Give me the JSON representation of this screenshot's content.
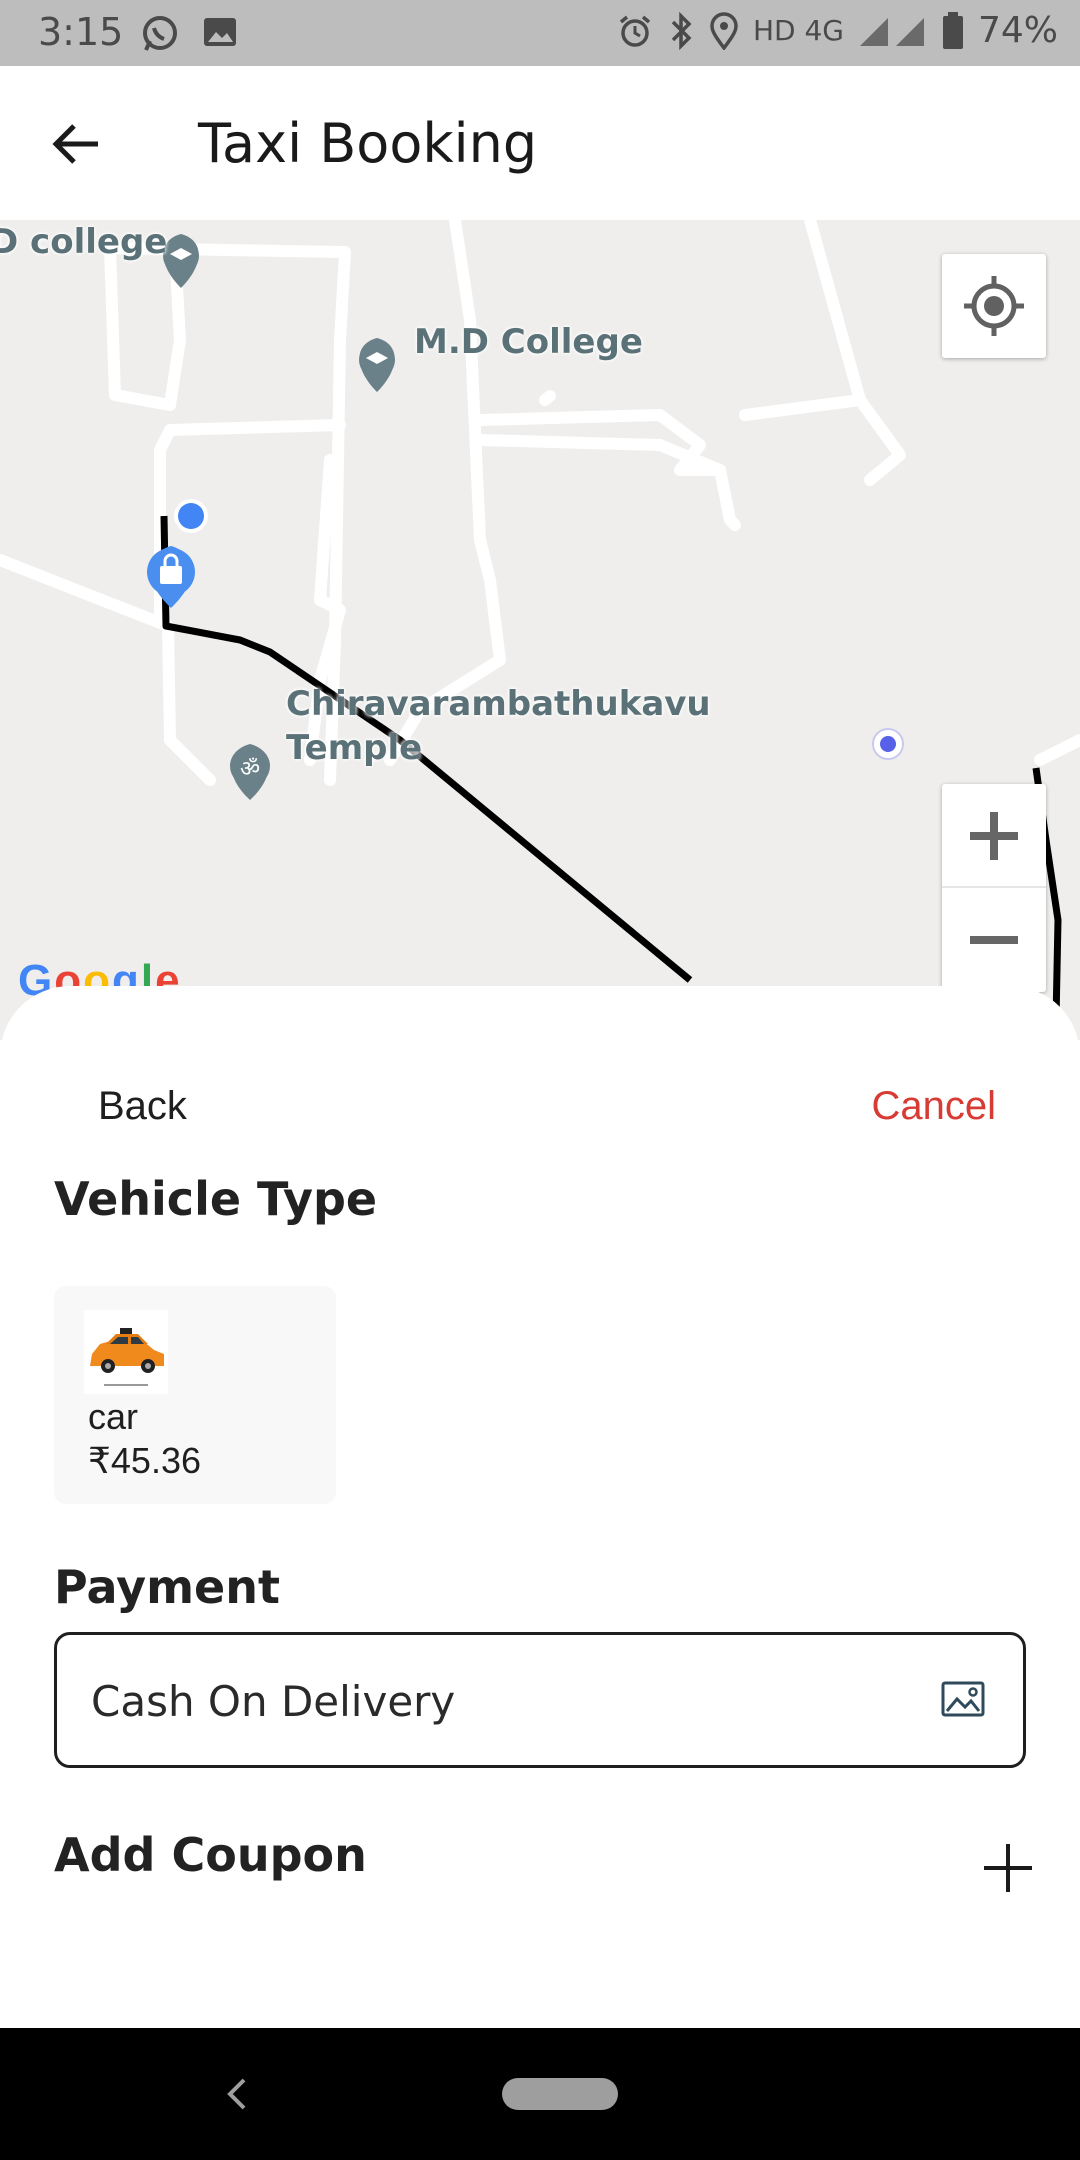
{
  "status_bar": {
    "time": "3:15",
    "network": "HD 4G",
    "battery": "74%",
    "icons": [
      "whatsapp-icon",
      "gallery-icon",
      "alarm-icon",
      "bluetooth-icon",
      "location-icon",
      "signal-icon",
      "battery-icon"
    ]
  },
  "header": {
    "title": "Taxi Booking",
    "back_icon": "arrow-left-icon"
  },
  "map": {
    "labels": {
      "college_partial": "D college",
      "md_college": "M.D College",
      "temple_line1": "Chiravarambathukavu",
      "temple_line2": "Temple"
    },
    "attribution": "Google",
    "controls": {
      "locate_icon": "my-location-icon",
      "zoom_in_icon": "plus-icon",
      "zoom_out_icon": "minus-icon"
    },
    "colors": {
      "route": "#000000",
      "user_dot": "#4285f4",
      "poi": "#6b8189"
    }
  },
  "sheet": {
    "back_label": "Back",
    "cancel_label": "Cancel",
    "vehicle_section_title": "Vehicle Type",
    "vehicles": [
      {
        "name": "car",
        "price": "₹45.36",
        "icon": "taxi-car-image"
      }
    ],
    "payment_section_title": "Payment",
    "payment_method": "Cash On Delivery",
    "payment_icon": "image-icon",
    "coupon_title": "Add Coupon",
    "coupon_icon": "plus-icon",
    "accent_color": "#d83a34"
  },
  "nav_bar": {
    "back_icon": "chevron-left-icon",
    "home_icon": "home-pill-icon"
  }
}
